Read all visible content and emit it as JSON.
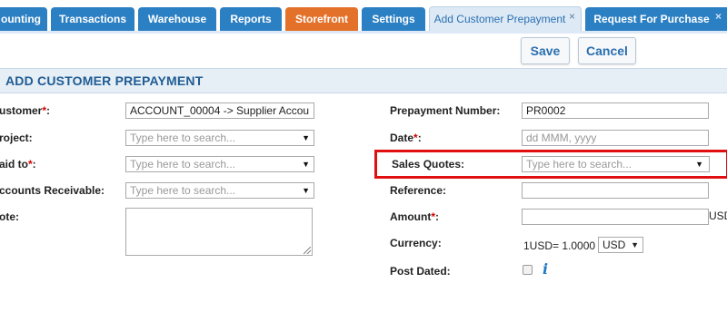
{
  "tabs": [
    {
      "label": "ounting"
    },
    {
      "label": "Transactions"
    },
    {
      "label": "Warehouse"
    },
    {
      "label": "Reports"
    },
    {
      "label": "Storefront"
    },
    {
      "label": "Settings"
    },
    {
      "label": "Add Customer Prepayment",
      "close": "×"
    },
    {
      "label": "Request For Purchase",
      "close": "×"
    }
  ],
  "toolbar": {
    "save_label": "Save",
    "cancel_label": "Cancel"
  },
  "section": {
    "title": "ADD CUSTOMER PREPAYMENT"
  },
  "form": {
    "required_mark": "*",
    "customer": {
      "label": "ustomer",
      "value": "ACCOUNT_00004 -> Supplier Accou"
    },
    "project": {
      "label": "roject:",
      "placeholder": "Type here to search..."
    },
    "paid_to": {
      "label": "aid to",
      "placeholder": "Type here to search..."
    },
    "accounts_receivable": {
      "label": "ccounts Receivable:",
      "placeholder": "Type here to search..."
    },
    "note": {
      "label": "ote:"
    },
    "prepayment_number": {
      "label": "Prepayment Number:",
      "value": "PR0002"
    },
    "date": {
      "label": "Date",
      "placeholder": "dd MMM, yyyy"
    },
    "sales_quotes": {
      "label": "Sales Quotes:",
      "placeholder": "Type here to search..."
    },
    "reference": {
      "label": "Reference:",
      "value": ""
    },
    "amount": {
      "label": "Amount",
      "currency_suffix": "USD",
      "value": ""
    },
    "currency": {
      "label": "Currency:",
      "rate": "1USD= 1.0000",
      "selected": "USD"
    },
    "post_dated": {
      "label": "Post Dated:"
    }
  },
  "colors": {
    "tab_blue": "#2b7fc3",
    "tab_orange": "#e4712a",
    "highlight": "#e01010",
    "section_bg": "#e6eef6"
  },
  "icons": {
    "dropdown": "▼",
    "info": "i"
  }
}
